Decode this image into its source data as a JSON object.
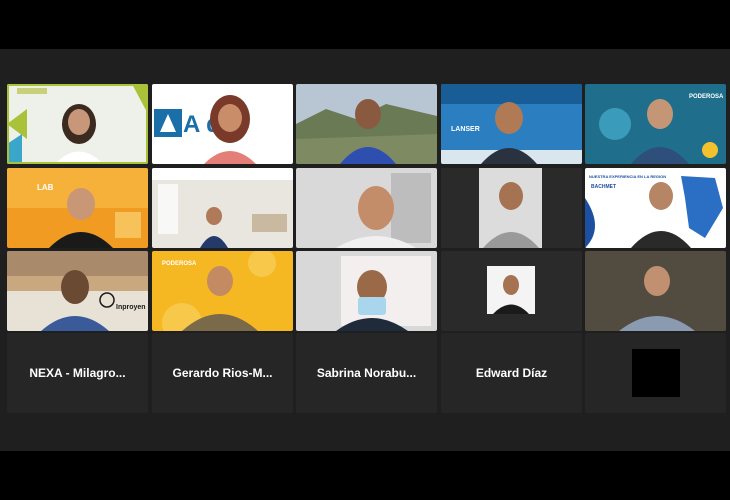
{
  "participants": [
    {
      "name": "NEXA - Milagro..."
    },
    {
      "name": "Gerardo Rios-M..."
    },
    {
      "name": "Sabrina Norabu..."
    },
    {
      "name": "Edward Díaz"
    }
  ],
  "backgrounds": {
    "tile2_text": "A  des",
    "tile4_text": "LANSER",
    "tile5_text": "PODEROSA",
    "tile6_text": "LAB",
    "tile10_title": "NUESTRA EXPERIENCIA EN LA REGION",
    "tile10_logo": "BACHMET",
    "tile11_text": "Inproyen",
    "tile12_text": "PODEROSA"
  },
  "colors": {
    "active_speaker": "#a9c23a",
    "stage_bg": "#1f1f1f",
    "tile_bg": "#2a2a2a"
  }
}
